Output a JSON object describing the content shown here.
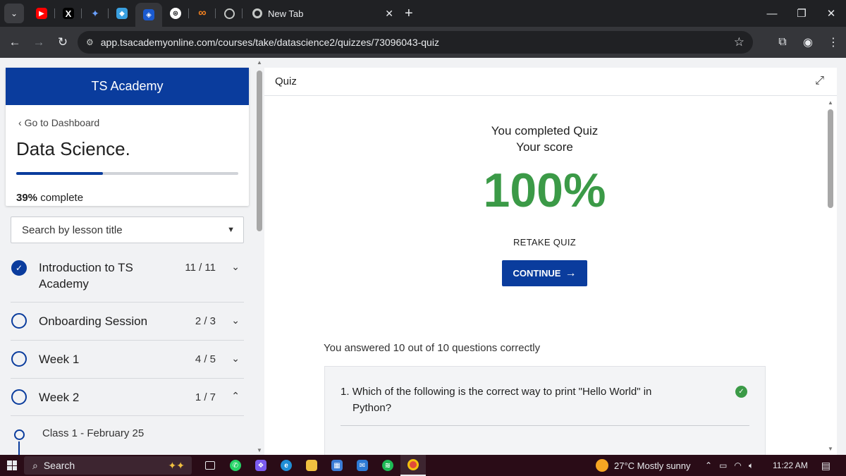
{
  "browser": {
    "tabs": [
      {
        "name": "youtube",
        "color": "#ff0000",
        "glyph": "▶"
      },
      {
        "name": "x",
        "color": "#000000",
        "glyph": "𝕏"
      },
      {
        "name": "gemini",
        "color": "#4a7cf0",
        "glyph": "✦"
      },
      {
        "name": "app",
        "color": "#3aa0e0",
        "glyph": "◆"
      },
      {
        "name": "tsacademy",
        "color": "#1a5ad0",
        "glyph": "◈"
      },
      {
        "name": "chatgpt",
        "color": "#ffffff",
        "glyph": "⊛"
      },
      {
        "name": "meta",
        "color": "#f08020",
        "glyph": "∞"
      },
      {
        "name": "globe",
        "color": "#c4c7c5",
        "glyph": "◍"
      }
    ],
    "new_tab_label": "New Tab",
    "url": "app.tsacademyonline.com/courses/take/datascience2/quizzes/73096043-quiz"
  },
  "sidebar": {
    "brand": "TS Academy",
    "back_link": "Go to Dashboard",
    "course_title": "Data Science.",
    "progress_percent": 39,
    "progress_value": "39%",
    "progress_suffix": " complete",
    "search_placeholder": "Search by lesson title",
    "sections": [
      {
        "title": "Introduction to TS Academy",
        "count": "11 / 11",
        "done": true,
        "expanded": false
      },
      {
        "title": "Onboarding Session",
        "count": "2 / 3",
        "done": false,
        "expanded": false
      },
      {
        "title": "Week 1",
        "count": "4 / 5",
        "done": false,
        "expanded": false
      },
      {
        "title": "Week 2",
        "count": "1 / 7",
        "done": false,
        "expanded": true
      }
    ],
    "lessons": [
      {
        "title": "Class 1 - February 25"
      }
    ]
  },
  "quiz": {
    "header": "Quiz",
    "completed_text": "You completed Quiz",
    "score_label": "Your score",
    "score": "100%",
    "retake_label": "RETAKE QUIZ",
    "continue_label": "CONTINUE",
    "answered_text": "You answered 10 out of 10 questions correctly",
    "questions": [
      {
        "number": "1.",
        "text": "Which of the following is the correct way to print \"Hello World\" in Python?",
        "correct": true
      }
    ]
  },
  "taskbar": {
    "search_label": "Search",
    "weather": "27°C  Mostly sunny",
    "time": "11:22 AM"
  }
}
